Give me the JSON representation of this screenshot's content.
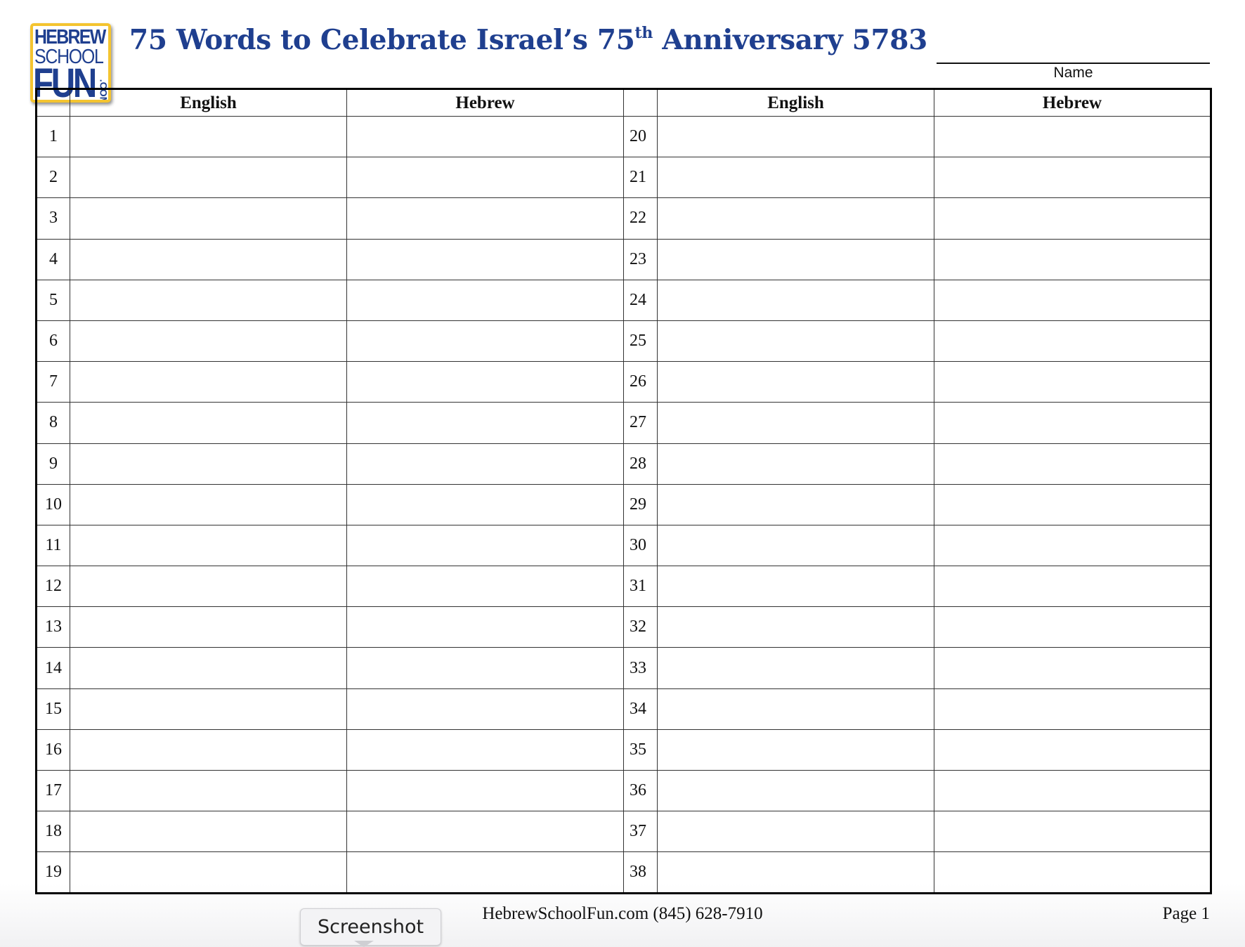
{
  "logo": {
    "line1": "HEBREW",
    "line2": "SCHOOL",
    "line3": "FUN",
    "line4": ".COM"
  },
  "title": {
    "main": "75 Words to Celebrate Israel’s 75",
    "superscript": "th",
    "rest": " Anniversary 5783"
  },
  "name_label": "Name",
  "table": {
    "headers": [
      "",
      "English",
      "Hebrew",
      "",
      "English",
      "Hebrew"
    ],
    "left_numbers": [
      "1",
      "2",
      "3",
      "4",
      "5",
      "6",
      "7",
      "8",
      "9",
      "10",
      "11",
      "12",
      "13",
      "14",
      "15",
      "16",
      "17",
      "18",
      "19"
    ],
    "right_numbers": [
      "20",
      "21",
      "22",
      "23",
      "24",
      "25",
      "26",
      "27",
      "28",
      "29",
      "30",
      "31",
      "32",
      "33",
      "34",
      "35",
      "36",
      "37",
      "38"
    ]
  },
  "footer": {
    "center": "HebrewSchoolFun.com (845) 628-7910",
    "page": "Page 1"
  },
  "tooltip": "Screenshot",
  "colors": {
    "title_blue": "#1f3f8f",
    "logo_border": "#f4c430"
  }
}
